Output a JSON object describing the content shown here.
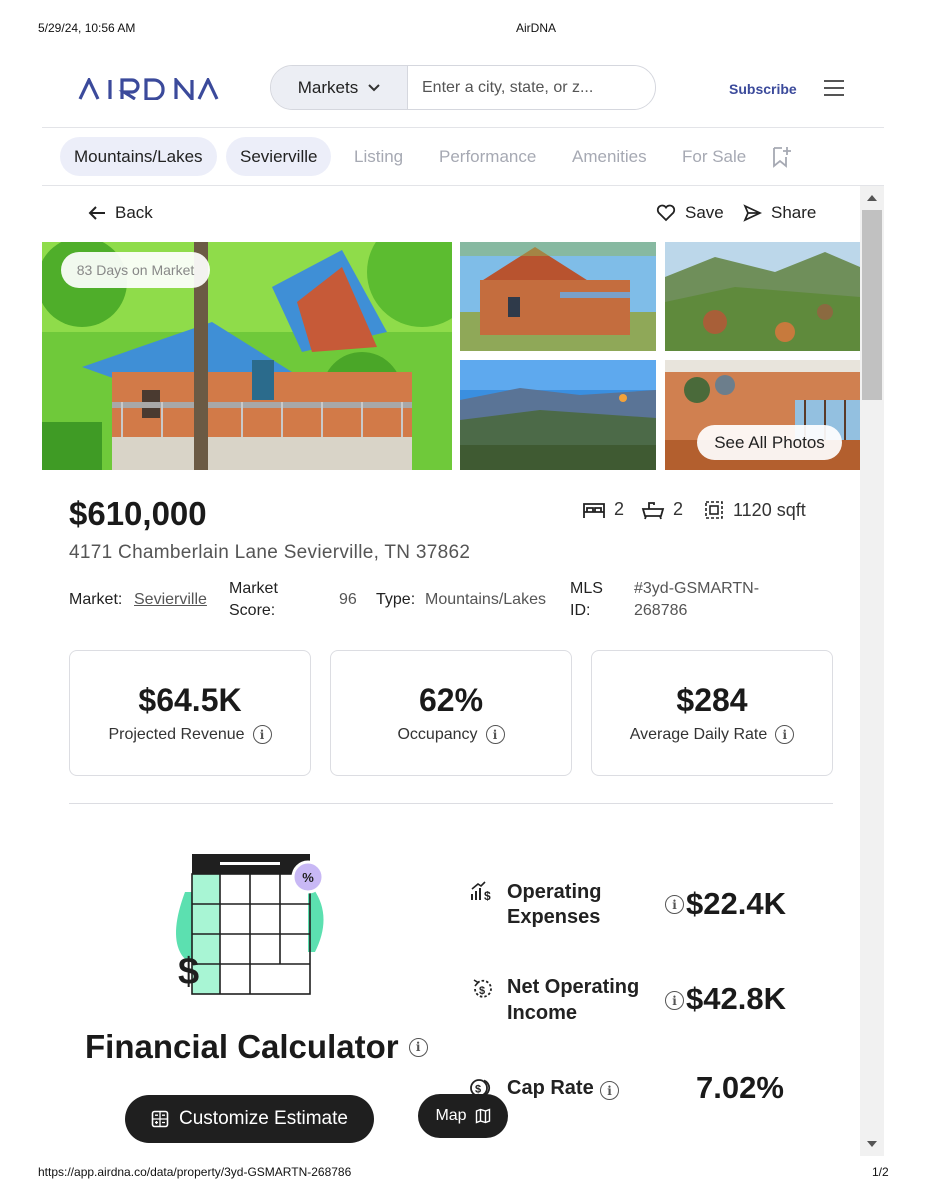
{
  "print": {
    "datetime": "5/29/24, 10:56 AM",
    "title": "AirDNA",
    "url": "https://app.airdna.co/data/property/3yd-GSMARTN-268786",
    "page": "1/2"
  },
  "header": {
    "logo_text": "AIRDNA",
    "market_select": "Markets",
    "search_placeholder": "Enter a city, state, or z...",
    "subscribe": "Subscribe"
  },
  "tabs": [
    {
      "label": "Mountains/Lakes",
      "state": "active"
    },
    {
      "label": "Sevierville",
      "state": "active"
    },
    {
      "label": "Listing",
      "state": "inactive"
    },
    {
      "label": "Performance",
      "state": "inactive"
    },
    {
      "label": "Amenities",
      "state": "inactive"
    },
    {
      "label": "For Sale",
      "state": "inactive"
    }
  ],
  "actions": {
    "back": "Back",
    "save": "Save",
    "share": "Share"
  },
  "photos": {
    "days_on_market": "83 Days on Market",
    "see_all": "See All Photos"
  },
  "property": {
    "price": "$610,000",
    "address": "4171 Chamberlain Lane Sevierville, TN 37862",
    "beds": "2",
    "baths": "2",
    "sqft": "1120 sqft",
    "market_label": "Market:",
    "market_value": "Sevierville",
    "score_label_1": "Market",
    "score_label_2": "Score:",
    "score_value": "96",
    "type_label": "Type:",
    "type_value": "Mountains/Lakes",
    "mls_label_1": "MLS",
    "mls_label_2": "ID:",
    "mls_value_1": "#3yd-GSMARTN-",
    "mls_value_2": "268786"
  },
  "metrics": [
    {
      "value": "$64.5K",
      "label": "Projected Revenue"
    },
    {
      "value": "62%",
      "label": "Occupancy"
    },
    {
      "value": "$284",
      "label": "Average Daily Rate"
    }
  ],
  "financial": {
    "title": "Financial Calculator",
    "items": [
      {
        "label_1": "Operating",
        "label_2": "Expenses",
        "value": "$22.4K"
      },
      {
        "label_1": "Net Operating",
        "label_2": "Income",
        "value": "$42.8K"
      },
      {
        "label_1": "Cap Rate",
        "label_2": "",
        "value": "7.02%"
      }
    ],
    "customize": "Customize Estimate",
    "map": "Map"
  },
  "colors": {
    "brand": "#3b4a9b",
    "accent_green": "#5ce0b0",
    "accent_purple": "#c8b8f5",
    "dark_button": "#1f1f1f"
  }
}
